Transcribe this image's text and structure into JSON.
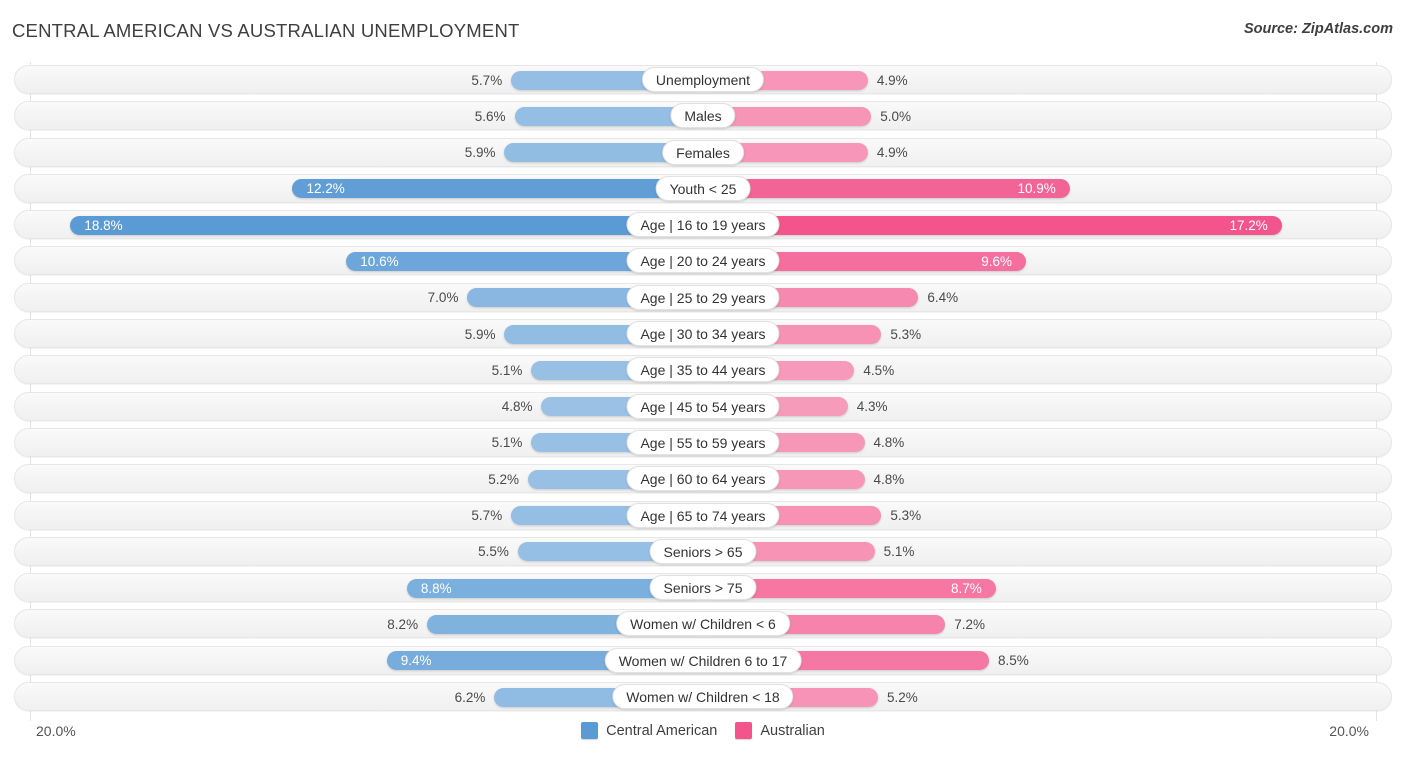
{
  "header": {
    "title": "CENTRAL AMERICAN VS AUSTRALIAN UNEMPLOYMENT",
    "source": "Source: ZipAtlas.com"
  },
  "axis": {
    "min_label": "20.0%",
    "max_label": "20.0%"
  },
  "legend": {
    "items": [
      {
        "label": "Central American",
        "color": "#5b9bd5"
      },
      {
        "label": "Australian",
        "color": "#f2548b"
      }
    ]
  },
  "colors": {
    "left_accent": "#5b9bd5",
    "right_accent": "#f2548b",
    "track": "#f4f4f4",
    "label_pill": "#ffffff"
  },
  "chart_data": {
    "type": "bar",
    "subtype": "diverging-bar",
    "title": "CENTRAL AMERICAN VS AUSTRALIAN UNEMPLOYMENT",
    "xlabel": "",
    "ylabel": "",
    "axis_max_percent": 20.0,
    "unit": "%",
    "grid": true,
    "legend_position": "bottom-center",
    "categories": [
      "Unemployment",
      "Males",
      "Females",
      "Youth < 25",
      "Age | 16 to 19 years",
      "Age | 20 to 24 years",
      "Age | 25 to 29 years",
      "Age | 30 to 34 years",
      "Age | 35 to 44 years",
      "Age | 45 to 54 years",
      "Age | 55 to 59 years",
      "Age | 60 to 64 years",
      "Age | 65 to 74 years",
      "Seniors > 65",
      "Seniors > 75",
      "Women w/ Children < 6",
      "Women w/ Children 6 to 17",
      "Women w/ Children < 18"
    ],
    "series": [
      {
        "name": "Central American",
        "side": "left",
        "color": "#5b9bd5",
        "values": [
          5.7,
          5.6,
          5.9,
          12.2,
          18.8,
          10.6,
          7.0,
          5.9,
          5.1,
          4.8,
          5.1,
          5.2,
          5.7,
          5.5,
          8.8,
          8.2,
          9.4,
          6.2
        ],
        "labels": [
          "5.7%",
          "5.6%",
          "5.9%",
          "12.2%",
          "18.8%",
          "10.6%",
          "7.0%",
          "5.9%",
          "5.1%",
          "4.8%",
          "5.1%",
          "5.2%",
          "5.7%",
          "5.5%",
          "8.8%",
          "8.2%",
          "9.4%",
          "6.2%"
        ]
      },
      {
        "name": "Australian",
        "side": "right",
        "color": "#f2548b",
        "values": [
          4.9,
          5.0,
          4.9,
          10.9,
          17.2,
          9.6,
          6.4,
          5.3,
          4.5,
          4.3,
          4.8,
          4.8,
          5.3,
          5.1,
          8.7,
          7.2,
          8.5,
          5.2
        ],
        "labels": [
          "4.9%",
          "5.0%",
          "4.9%",
          "10.9%",
          "17.2%",
          "9.6%",
          "6.4%",
          "5.3%",
          "4.5%",
          "4.3%",
          "4.8%",
          "4.8%",
          "5.3%",
          "5.1%",
          "8.7%",
          "7.2%",
          "8.5%",
          "5.2%"
        ]
      }
    ]
  }
}
